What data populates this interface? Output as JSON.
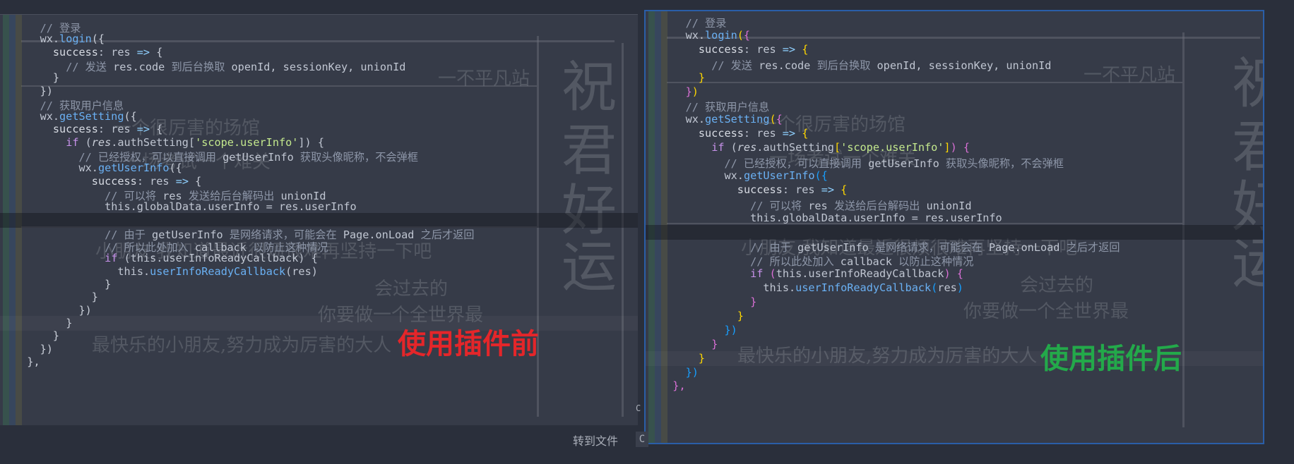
{
  "before": {
    "caption": "使用插件前",
    "lines": [
      [
        [
          "c-comment",
          "// 登录"
        ]
      ],
      [
        [
          "c-var",
          "wx"
        ],
        [
          "c-var",
          "."
        ],
        [
          "c-fn",
          "login"
        ],
        [
          "c-brace",
          "({"
        ]
      ],
      [
        [
          "c-prop",
          "success"
        ],
        [
          "c-var",
          ": "
        ],
        [
          "c-param",
          "res"
        ],
        [
          "c-op",
          " => "
        ],
        [
          "c-brace",
          "{"
        ]
      ],
      [
        [
          "c-comment",
          "// 发送 "
        ],
        [
          "c-var",
          "res.code"
        ],
        [
          "c-comment",
          " 到后台换取 "
        ],
        [
          "c-var",
          "openId, sessionKey, unionId"
        ]
      ],
      [
        [
          "c-brace",
          "}"
        ]
      ],
      [
        [
          "c-brace",
          "})"
        ]
      ],
      [
        [
          "c-comment",
          "// 获取用户信息"
        ]
      ],
      [
        [
          "c-var",
          "wx."
        ],
        [
          "c-fn",
          "getSetting"
        ],
        [
          "c-brace",
          "({"
        ]
      ],
      [
        [
          "c-prop",
          "success"
        ],
        [
          "c-var",
          ": "
        ],
        [
          "c-param",
          "res"
        ],
        [
          "c-op",
          " => "
        ],
        [
          "c-brace",
          "{"
        ]
      ],
      [
        [
          "c-kw",
          "if"
        ],
        [
          "c-var",
          " ("
        ],
        [
          "c-italic",
          "res"
        ],
        [
          "c-var",
          ".authSetting["
        ],
        [
          "c-str",
          "'scope.userInfo'"
        ],
        [
          "c-var",
          "]) {"
        ]
      ],
      [
        [
          "c-comment",
          "// 已经授权，可以直接调用 "
        ],
        [
          "c-var",
          "getUserInfo"
        ],
        [
          "c-comment",
          " 获取头像昵称，不会弹框"
        ]
      ],
      [
        [
          "c-var",
          "wx."
        ],
        [
          "c-fn",
          "getUserInfo"
        ],
        [
          "c-brace",
          "({"
        ]
      ],
      [
        [
          "c-prop",
          "success"
        ],
        [
          "c-var",
          ": "
        ],
        [
          "c-param",
          "res"
        ],
        [
          "c-op",
          " => "
        ],
        [
          "c-brace",
          "{"
        ]
      ],
      [
        [
          "c-comment",
          "// 可以将 "
        ],
        [
          "c-var",
          "res"
        ],
        [
          "c-comment",
          " 发送给后台解码出 "
        ],
        [
          "c-var",
          "unionId"
        ]
      ],
      [
        [
          "c-var",
          "this.globalData.userInfo = res.userInfo"
        ]
      ],
      [],
      [
        [
          "c-comment",
          "// 由于 "
        ],
        [
          "c-var",
          "getUserInfo"
        ],
        [
          "c-comment",
          " 是网络请求，可能会在 "
        ],
        [
          "c-var",
          "Page.onLoad"
        ],
        [
          "c-comment",
          " 之后才返回"
        ]
      ],
      [
        [
          "c-comment",
          "// 所以此处加入 "
        ],
        [
          "c-var",
          "callback"
        ],
        [
          "c-comment",
          " 以防止这种情况"
        ]
      ],
      [
        [
          "c-kw",
          "if"
        ],
        [
          "c-var",
          " (this.userInfoReadyCallback) {"
        ]
      ],
      [
        [
          "c-var",
          "this."
        ],
        [
          "c-fn",
          "userInfoReadyCallback"
        ],
        [
          "c-var",
          "(res)"
        ]
      ],
      [
        [
          "c-brace",
          "}"
        ]
      ],
      [
        [
          "c-brace",
          "}"
        ]
      ],
      [
        [
          "c-brace",
          "})"
        ]
      ],
      [
        [
          "c-brace",
          "}"
        ]
      ],
      [
        [
          "c-brace",
          "}"
        ]
      ],
      [
        [
          "c-brace",
          "})"
        ]
      ],
      [
        [
          "c-brace",
          "},"
        ]
      ]
    ]
  },
  "after": {
    "caption": "使用插件后",
    "lines": [
      [
        [
          "c-comment",
          "// 登录"
        ]
      ],
      [
        [
          "c-var",
          "wx."
        ],
        [
          "c-fn",
          "login"
        ],
        [
          "c-b-yellow",
          "("
        ],
        [
          "c-b-pink",
          "{"
        ]
      ],
      [
        [
          "c-prop",
          "success"
        ],
        [
          "c-var",
          ": "
        ],
        [
          "c-param",
          "res"
        ],
        [
          "c-op",
          " => "
        ],
        [
          "c-b-yellow",
          "{"
        ]
      ],
      [
        [
          "c-comment",
          "// 发送 "
        ],
        [
          "c-var",
          "res.code"
        ],
        [
          "c-comment",
          " 到后台换取 "
        ],
        [
          "c-var",
          "openId, sessionKey, unionId"
        ]
      ],
      [
        [
          "c-b-yellow",
          "}"
        ]
      ],
      [
        [
          "c-b-pink",
          "}"
        ],
        [
          "c-b-yellow",
          ")"
        ]
      ],
      [
        [
          "c-comment",
          "// 获取用户信息"
        ]
      ],
      [
        [
          "c-var",
          "wx."
        ],
        [
          "c-fn",
          "getSetting"
        ],
        [
          "c-b-yellow",
          "("
        ],
        [
          "c-b-pink",
          "{"
        ]
      ],
      [
        [
          "c-prop",
          "success"
        ],
        [
          "c-var",
          ": "
        ],
        [
          "c-param",
          "res"
        ],
        [
          "c-op",
          " => "
        ],
        [
          "c-b-yellow",
          "{"
        ]
      ],
      [
        [
          "c-kw",
          "if"
        ],
        [
          "c-var",
          " ("
        ],
        [
          "c-italic",
          "res"
        ],
        [
          "c-var",
          ".authSetting"
        ],
        [
          "c-b-yellow",
          "["
        ],
        [
          "c-str",
          "'scope.userInfo'"
        ],
        [
          "c-b-yellow",
          "]"
        ],
        [
          "c-b-pink",
          ")"
        ],
        [
          "c-b-pink",
          " {"
        ]
      ],
      [
        [
          "c-comment",
          "// 已经授权，可以直接调用 "
        ],
        [
          "c-var",
          "getUserInfo"
        ],
        [
          "c-comment",
          " 获取头像昵称，不会弹框"
        ]
      ],
      [
        [
          "c-var",
          "wx."
        ],
        [
          "c-fn",
          "getUserInfo"
        ],
        [
          "c-b-blue",
          "("
        ],
        [
          "c-b-blue",
          "{"
        ]
      ],
      [
        [
          "c-prop",
          "success"
        ],
        [
          "c-var",
          ": "
        ],
        [
          "c-param",
          "res"
        ],
        [
          "c-op",
          " => "
        ],
        [
          "c-b-yellow",
          "{"
        ]
      ],
      [
        [
          "c-comment",
          "// 可以将 "
        ],
        [
          "c-var",
          "res"
        ],
        [
          "c-comment",
          " 发送给后台解码出 "
        ],
        [
          "c-var",
          "unionId"
        ]
      ],
      [
        [
          "c-var",
          "this.globalData.userInfo = res.userInfo"
        ]
      ],
      [],
      [
        [
          "c-comment",
          "// 由于 "
        ],
        [
          "c-var",
          "getUserInfo"
        ],
        [
          "c-comment",
          " 是网络请求，可能会在 "
        ],
        [
          "c-var",
          "Page.onLoad"
        ],
        [
          "c-comment",
          " 之后才返回"
        ]
      ],
      [
        [
          "c-comment",
          "// 所以此处加入 "
        ],
        [
          "c-var",
          "callback"
        ],
        [
          "c-comment",
          " 以防止这种情况"
        ]
      ],
      [
        [
          "c-kw",
          "if"
        ],
        [
          "c-var",
          " "
        ],
        [
          "c-b-pink",
          "("
        ],
        [
          "c-var",
          "this.userInfoReadyCallback"
        ],
        [
          "c-b-pink",
          ")"
        ],
        [
          "c-b-pink",
          " {"
        ]
      ],
      [
        [
          "c-var",
          "this."
        ],
        [
          "c-fn",
          "userInfoReadyCallback"
        ],
        [
          "c-b-blue",
          "("
        ],
        [
          "c-var",
          "res"
        ],
        [
          "c-b-blue",
          ")"
        ]
      ],
      [
        [
          "c-b-pink",
          "}"
        ]
      ],
      [
        [
          "c-b-yellow",
          "}"
        ]
      ],
      [
        [
          "c-b-blue",
          "})"
        ]
      ],
      [
        [
          "c-b-pink",
          "}"
        ]
      ],
      [
        [
          "c-b-yellow",
          "}"
        ]
      ],
      [
        [
          "c-b-blue",
          "})"
        ]
      ],
      [
        [
          "c-b-pink",
          "},"
        ]
      ]
    ]
  },
  "goto_file_label": "转到文件",
  "goto_file_key": "C",
  "scroll_marker": "C",
  "background_text": [
    "祝",
    "君",
    "好",
    "运",
    "小朋友,我知道最近很烦很难再坚持一下吧",
    "会过去的",
    "你要做一个全世界最",
    "最快乐的小朋友,努力成为厉害的大人",
    "一个很厉害的场馆",
    "一场考试一个难关",
    "一不平凡站"
  ]
}
